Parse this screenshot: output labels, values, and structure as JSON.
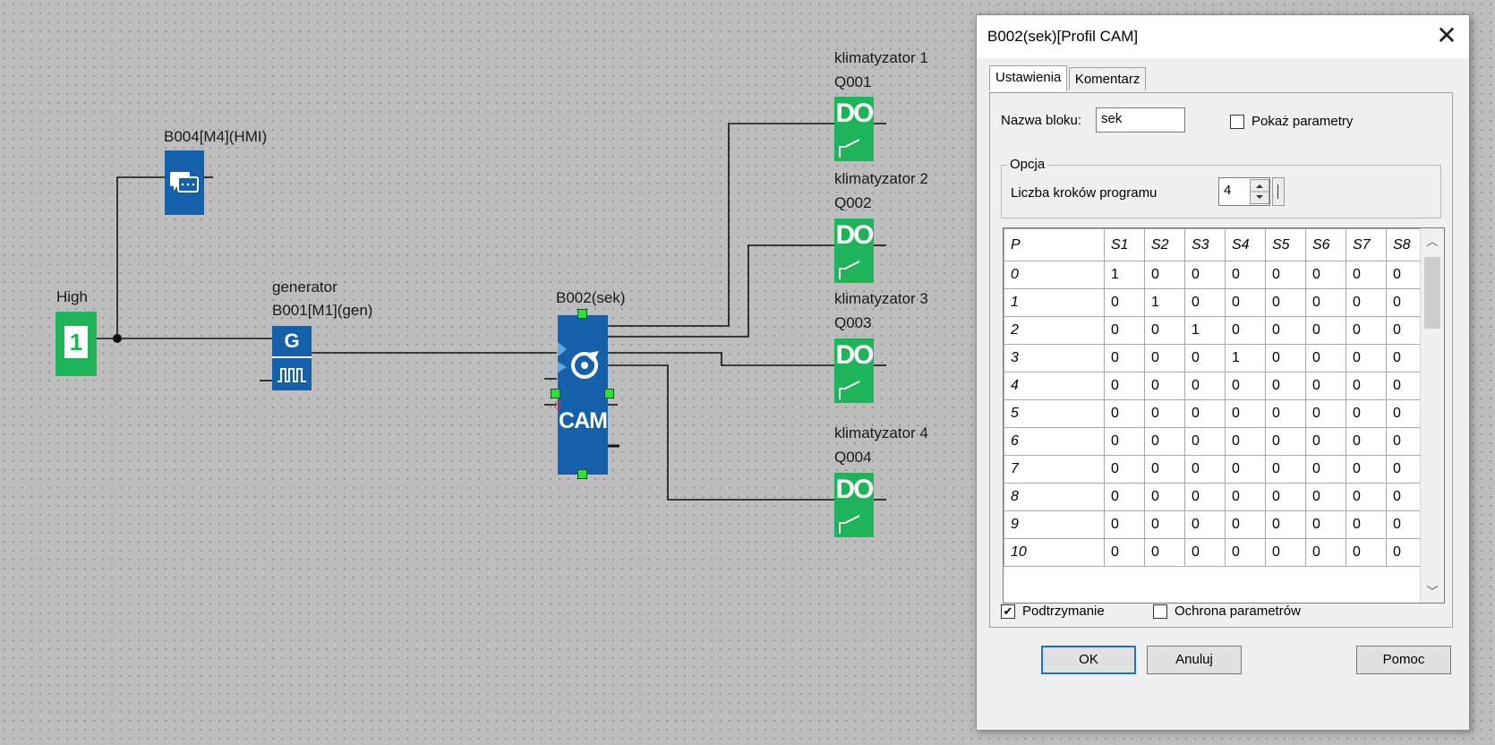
{
  "diagram": {
    "high_label": "High",
    "high_value": "1",
    "hmi_label": "B004[M4](HMI)",
    "generator_name": "generator",
    "generator_label": "B001[M1](gen)",
    "generator_letter": "G",
    "cam_label": "B002(sek)",
    "cam_text": "CAM",
    "outputs": [
      {
        "name": "klimatyzator 1",
        "id": "Q001",
        "text": "DO"
      },
      {
        "name": "klimatyzator 2",
        "id": "Q002",
        "text": "DO"
      },
      {
        "name": "klimatyzator 3",
        "id": "Q003",
        "text": "DO"
      },
      {
        "name": "klimatyzator 4",
        "id": "Q004",
        "text": "DO"
      }
    ]
  },
  "dialog": {
    "title": "B002(sek)[Profil CAM]",
    "close_glyph": "✕",
    "tabs": [
      "Ustawienia",
      "Komentarz"
    ],
    "block_name_label": "Nazwa bloku:",
    "block_name_value": "sek",
    "show_params_label": "Pokaż parametry",
    "show_params_checked": false,
    "option_group": "Opcja",
    "steps_label": "Liczba kroków programu",
    "steps_value": "4",
    "table": {
      "headers": [
        "P",
        "S1",
        "S2",
        "S3",
        "S4",
        "S5",
        "S6",
        "S7",
        "S8"
      ],
      "rows": [
        [
          "0",
          "1",
          "0",
          "0",
          "0",
          "0",
          "0",
          "0",
          "0"
        ],
        [
          "1",
          "0",
          "1",
          "0",
          "0",
          "0",
          "0",
          "0",
          "0"
        ],
        [
          "2",
          "0",
          "0",
          "1",
          "0",
          "0",
          "0",
          "0",
          "0"
        ],
        [
          "3",
          "0",
          "0",
          "0",
          "1",
          "0",
          "0",
          "0",
          "0"
        ],
        [
          "4",
          "0",
          "0",
          "0",
          "0",
          "0",
          "0",
          "0",
          "0"
        ],
        [
          "5",
          "0",
          "0",
          "0",
          "0",
          "0",
          "0",
          "0",
          "0"
        ],
        [
          "6",
          "0",
          "0",
          "0",
          "0",
          "0",
          "0",
          "0",
          "0"
        ],
        [
          "7",
          "0",
          "0",
          "0",
          "0",
          "0",
          "0",
          "0",
          "0"
        ],
        [
          "8",
          "0",
          "0",
          "0",
          "0",
          "0",
          "0",
          "0",
          "0"
        ],
        [
          "9",
          "0",
          "0",
          "0",
          "0",
          "0",
          "0",
          "0",
          "0"
        ],
        [
          "10",
          "0",
          "0",
          "0",
          "0",
          "0",
          "0",
          "0",
          "0"
        ]
      ]
    },
    "retention_label": "Podtrzymanie",
    "retention_checked": true,
    "protection_label": "Ochrona parametrów",
    "protection_checked": false,
    "buttons": {
      "ok": "OK",
      "cancel": "Anuluj",
      "help": "Pomoc"
    }
  },
  "colors": {
    "do_green": "#1fb45a",
    "block_blue": "#1560aa"
  }
}
